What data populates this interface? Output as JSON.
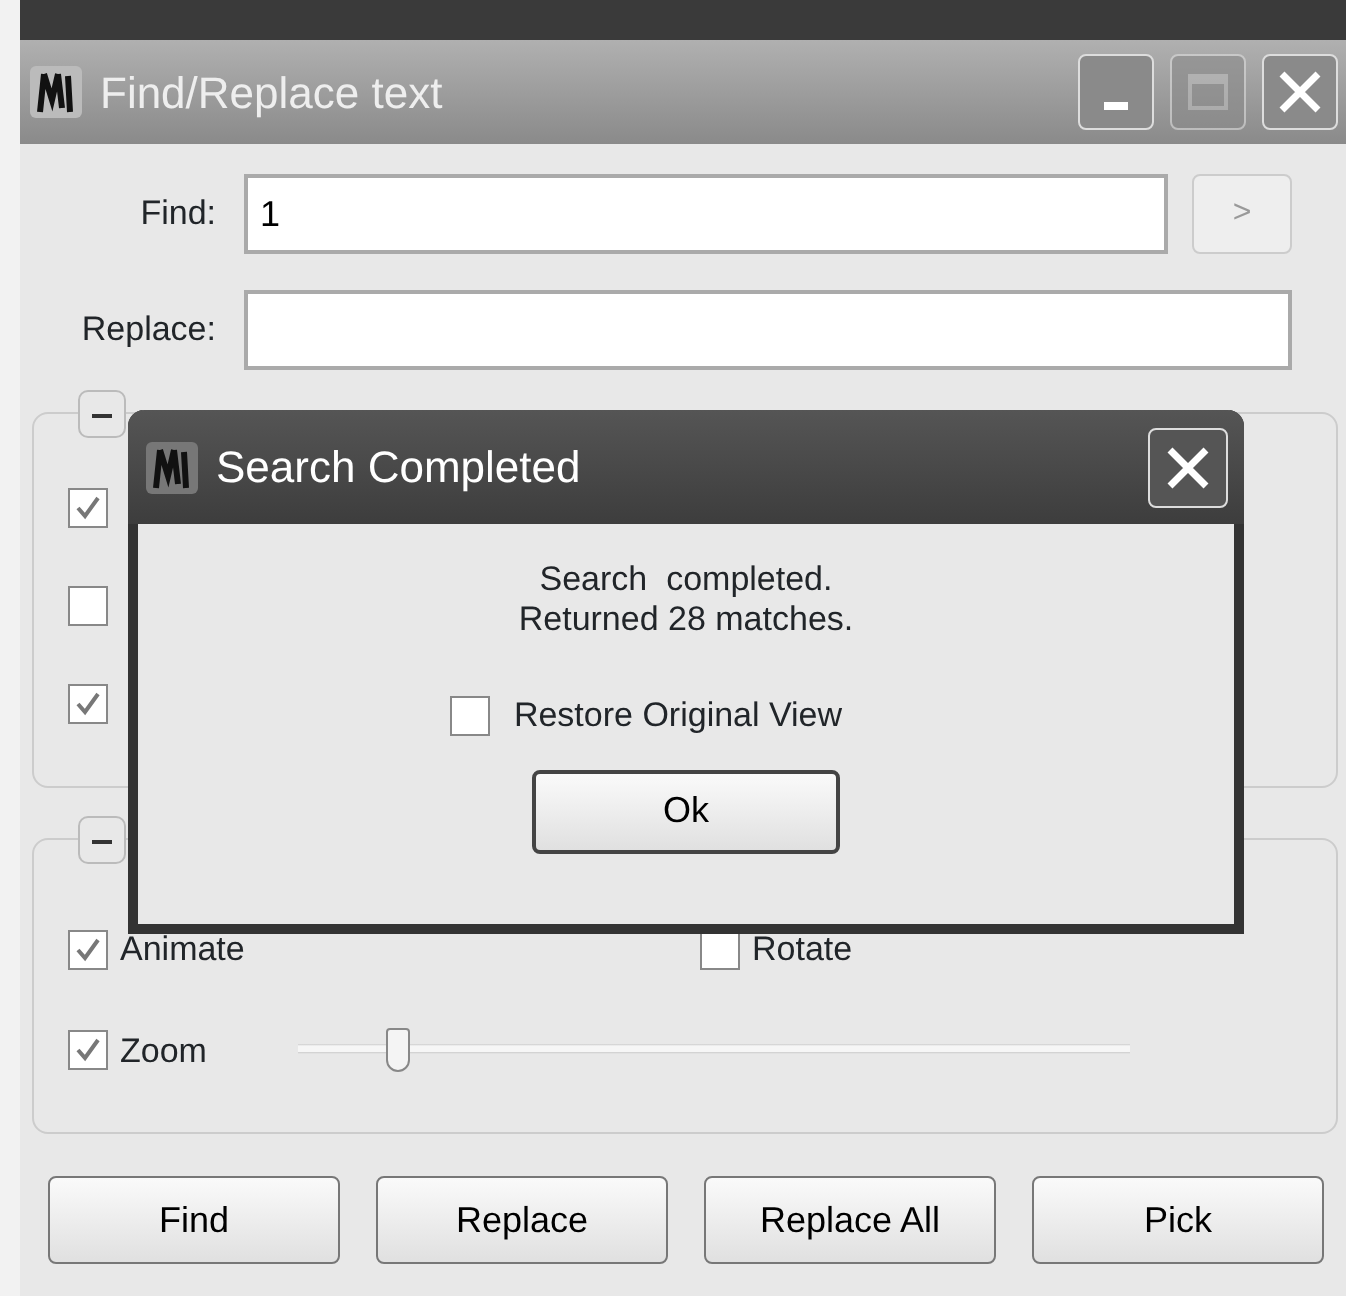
{
  "window": {
    "title": "Find/Replace text"
  },
  "find": {
    "label": "Find:",
    "value": "1",
    "next_button": ">"
  },
  "replace": {
    "label": "Replace:"
  },
  "find_options": {
    "expanded": true,
    "options": [
      {
        "checked": true
      },
      {
        "checked": false
      },
      {
        "checked": true
      }
    ]
  },
  "view_options": {
    "expanded": true,
    "animate": {
      "label": "Animate",
      "checked": true
    },
    "rotate": {
      "label": "Rotate",
      "checked": false
    },
    "zoom": {
      "label": "Zoom",
      "checked": true,
      "level": 0.12
    }
  },
  "buttons": [
    "Find",
    "Replace",
    "Replace All",
    "Pick"
  ],
  "dialog": {
    "title": "Search Completed",
    "message_lines": [
      "Search  completed.",
      "Returned 28 matches."
    ],
    "restore": {
      "label": "Restore Original View",
      "checked": false
    },
    "ok": "Ok"
  }
}
